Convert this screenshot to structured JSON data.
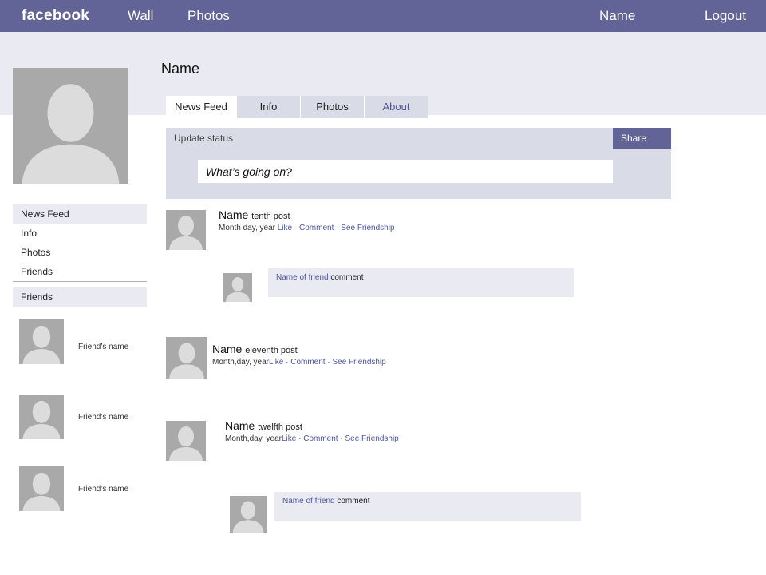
{
  "header": {
    "logo": "facebook",
    "nav": [
      "Wall",
      "Photos"
    ],
    "user_name": "Name",
    "logout": "Logout"
  },
  "profile": {
    "name": "Name",
    "tabs": [
      "News Feed",
      "Info",
      "Photos",
      "About"
    ]
  },
  "status": {
    "label": "Update status",
    "placeholder": "What’s going on?",
    "share": "Share"
  },
  "sidebar": {
    "items": [
      "News Feed",
      "Info",
      "Photos",
      "Friends"
    ],
    "friends_header": "Friends",
    "friends": [
      "Friend’s name",
      "Friend’s name",
      "Friend’s name"
    ]
  },
  "posts": [
    {
      "author": "Name",
      "text": "tenth post",
      "date": "Month day, year",
      "actions": [
        "Like",
        "Comment",
        "See Friendship"
      ],
      "comment": {
        "friend": "Name of friend",
        "text": "comment"
      }
    },
    {
      "author": "Name",
      "text": "eleventh post",
      "date": "Month,day, year",
      "actions": [
        "Like",
        "Comment",
        "See Friendship"
      ]
    },
    {
      "author": "Name",
      "text": "twelfth post",
      "date": "Month,day, year",
      "actions": [
        "Like",
        "Comment",
        "See Friendship"
      ],
      "comment": {
        "friend": "Name of friend",
        "text": "comment"
      }
    }
  ],
  "colors": {
    "topbar": "#626397",
    "band": "#e9eaf2",
    "panel": "#d9dbe7",
    "link": "#4d55a0",
    "avatar_bg": "#a9a9a9",
    "avatar_fg": "#dcdcdc"
  }
}
